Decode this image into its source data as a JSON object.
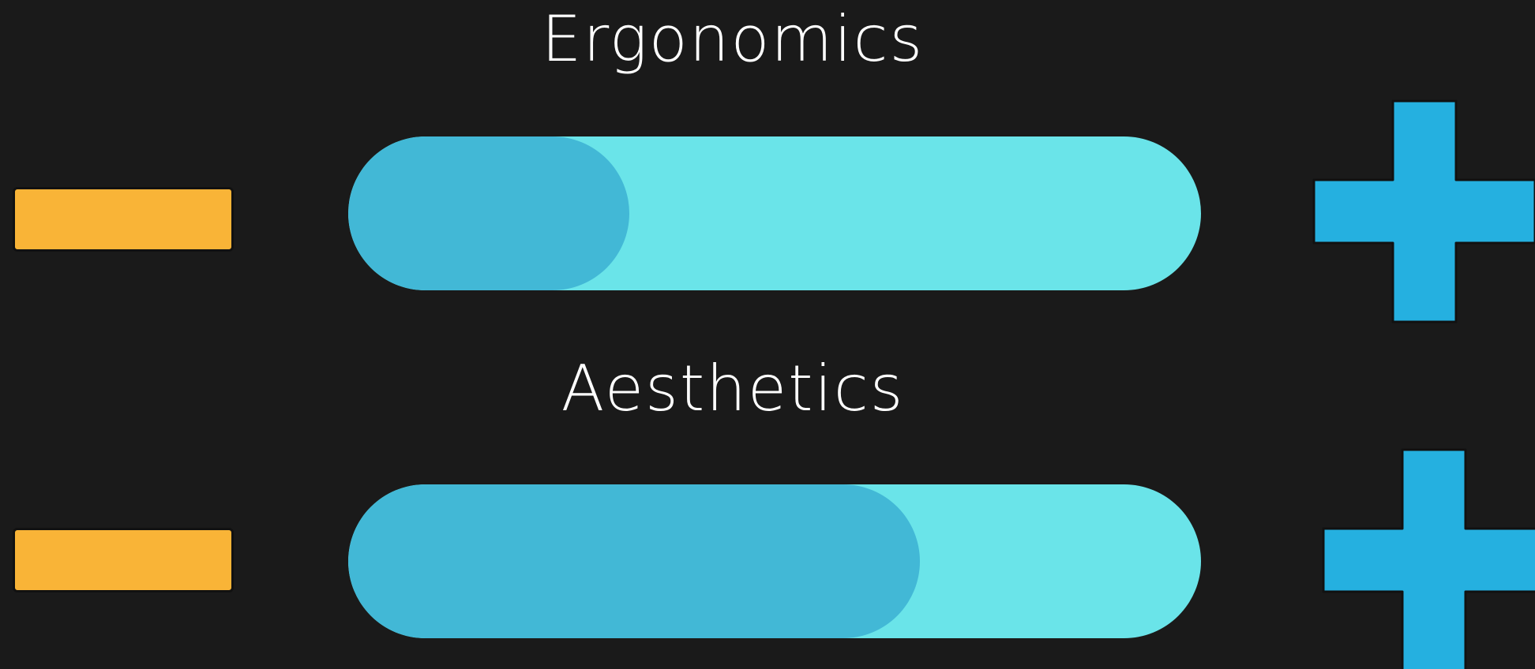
{
  "colors": {
    "background": "#1a1a1a",
    "label_text": "#ffffff",
    "track": "#6ae4e9",
    "fill": "#42b8d6",
    "minus_button": "#f9b437",
    "plus_button": "#25b0e0",
    "button_border": "#111111"
  },
  "sliders": [
    {
      "label": "Ergonomics",
      "fill_fraction": 0.33,
      "decrease_icon": "minus-icon",
      "increase_icon": "plus-icon"
    },
    {
      "label": "Aesthetics",
      "fill_fraction": 0.67,
      "decrease_icon": "minus-icon",
      "increase_icon": "plus-icon"
    }
  ]
}
